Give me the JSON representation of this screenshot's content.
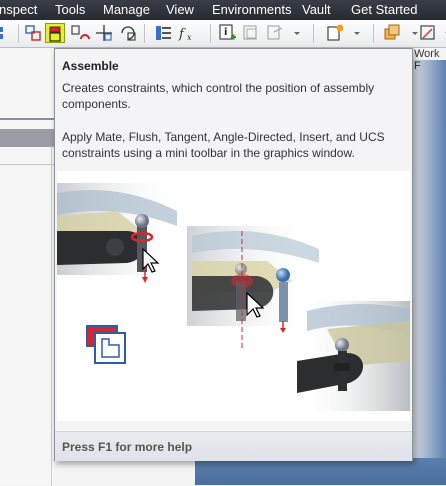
{
  "menu": {
    "items": [
      "nspect",
      "Tools",
      "Manage",
      "View",
      "Environments",
      "Vault",
      "Get Started"
    ]
  },
  "ribbon": {
    "buttons": [
      "grid-icon",
      "place-icon",
      "assemble-icon",
      "constrain-icon",
      "move-icon",
      "rotate-icon",
      "bom-icon",
      "parameters-icon",
      "ilogic-add-icon",
      "derive-icon",
      "copy-icon",
      "create-component-icon",
      "pattern-icon",
      "view-icon"
    ],
    "partial_label": "Work F"
  },
  "tooltip": {
    "title": "Assemble",
    "description": "Creates constraints, which control the position of assembly components.",
    "detail": "Apply Mate, Flush, Tangent, Angle-Directed, Insert, and UCS constraints using a mini toolbar in the graphics window.",
    "footer": "Press F1 for more help"
  },
  "colors": {
    "menubar": "#2e3238",
    "highlight": "#e6ef27",
    "canvas": "#5079ab",
    "constraint_red": "#d8262f"
  }
}
